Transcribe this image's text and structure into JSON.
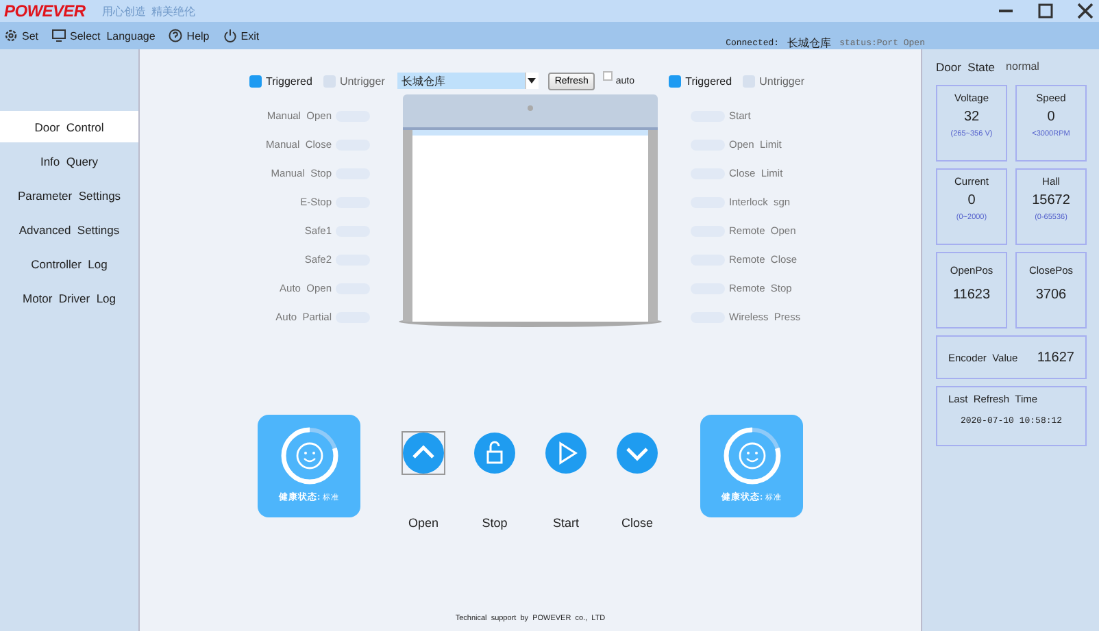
{
  "header": {
    "logo": "POWEVER",
    "slogan": "用心创造  精美绝伦"
  },
  "menu": [
    {
      "label": "Set",
      "kind": "gear"
    },
    {
      "label": "Select  Language",
      "kind": "monitor"
    },
    {
      "label": "Help",
      "kind": "help"
    },
    {
      "label": "Exit",
      "kind": "power"
    }
  ],
  "connection": {
    "label": "Connected:",
    "site": "长城仓库",
    "status": "status:Port Open"
  },
  "sidebar": {
    "items": [
      {
        "label": "Door  Control",
        "selected": true
      },
      {
        "label": "Info  Query",
        "selected": false
      },
      {
        "label": "Parameter  Settings",
        "selected": false
      },
      {
        "label": "Advanced  Settings",
        "selected": false
      },
      {
        "label": "Controller  Log",
        "selected": false
      },
      {
        "label": "Motor  Driver  Log",
        "selected": false
      }
    ]
  },
  "legend_left": {
    "triggered": "Triggered",
    "untrigger": "Untrigger"
  },
  "site_select": {
    "value": "长城仓库"
  },
  "refresh_button": "Refresh",
  "auto": {
    "label": "auto",
    "checked": false
  },
  "legend_right": {
    "triggered": "Triggered",
    "untrigger": "Untrigger"
  },
  "inputs_left": [
    {
      "label": "Manual  Open",
      "on": false
    },
    {
      "label": "Manual  Close",
      "on": false
    },
    {
      "label": "Manual  Stop",
      "on": false
    },
    {
      "label": "E-Stop",
      "on": false
    },
    {
      "label": "Safe1",
      "on": false
    },
    {
      "label": "Safe2",
      "on": false
    },
    {
      "label": "Auto  Open",
      "on": false
    },
    {
      "label": "Auto  Partial",
      "on": false
    }
  ],
  "inputs_right": [
    {
      "label": "Start",
      "on": false
    },
    {
      "label": "Open  Limit",
      "on": false
    },
    {
      "label": "Close  Limit",
      "on": false
    },
    {
      "label": "Interlock  sgn",
      "on": false
    },
    {
      "label": "Remote  Open",
      "on": false
    },
    {
      "label": "Remote  Close",
      "on": false
    },
    {
      "label": "Remote  Stop",
      "on": false
    },
    {
      "label": "Wireless  Press",
      "on": false
    }
  ],
  "health_cards": [
    {
      "label": "健康状态:",
      "value": "标准"
    },
    {
      "label": "健康状态:",
      "value": "标准"
    }
  ],
  "controls": [
    {
      "label": "Open",
      "kind": "up",
      "selected": true
    },
    {
      "label": "Stop",
      "kind": "lock",
      "selected": false
    },
    {
      "label": "Start",
      "kind": "play",
      "selected": false
    },
    {
      "label": "Close",
      "kind": "down",
      "selected": false
    }
  ],
  "footer": "Technical  support  by  POWEVER  co.,  LTD",
  "door_state": {
    "label": "Door  State",
    "value": "normal"
  },
  "readings": [
    {
      "label": "Voltage",
      "value": "32",
      "range": "(265~356 V)"
    },
    {
      "label": "Speed",
      "value": "0",
      "range": "<3000RPM"
    },
    {
      "label": "Current",
      "value": "0",
      "range": "(0~2000)"
    },
    {
      "label": "Hall",
      "value": "15672",
      "range": "(0-65536)"
    },
    {
      "label": "OpenPos",
      "value": "11623"
    },
    {
      "label": "ClosePos",
      "value": "3706"
    }
  ],
  "encoder": {
    "label": "Encoder  Value",
    "value": "11627"
  },
  "last_refresh": {
    "label": "Last  Refresh  Time",
    "value": "2020-07-10 10:58:12"
  }
}
